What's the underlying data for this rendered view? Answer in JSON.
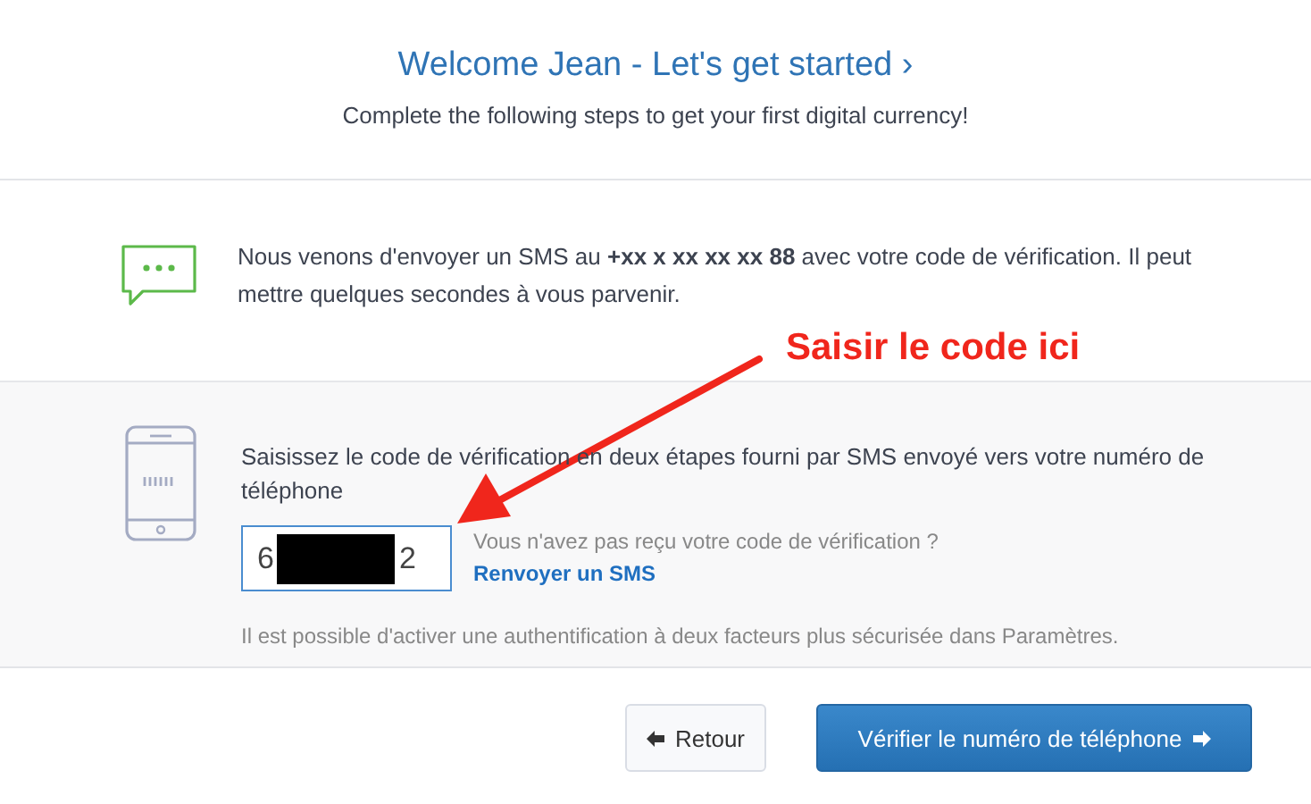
{
  "header": {
    "title": "Welcome Jean - Let's get started ›",
    "subtitle": "Complete the following steps to get your first digital currency!"
  },
  "sms_notice": {
    "text": "Nous venons d'envoyer un SMS au **+xx x xx xx xx 88** avec votre code de vérification. Il peut mettre quelques secondes à vous parvenir."
  },
  "verification": {
    "instruction": "Saisissez le code de vérification en deux étapes fourni par SMS envoyé vers votre numéro de téléphone",
    "code_start": "6",
    "code_end": "2",
    "not_received": "Vous n'avez pas reçu votre code de vérification ?",
    "resend_link": "Renvoyer un SMS",
    "note": "Il est possible d'activer une authentification à deux facteurs plus sécurisée dans Paramètres."
  },
  "annotation": {
    "label": "Saisir le code ici"
  },
  "buttons": [
    {
      "kind": "back",
      "label": "Retour"
    },
    {
      "kind": "primary",
      "label": "Vérifier le numéro de téléphone"
    }
  ]
}
